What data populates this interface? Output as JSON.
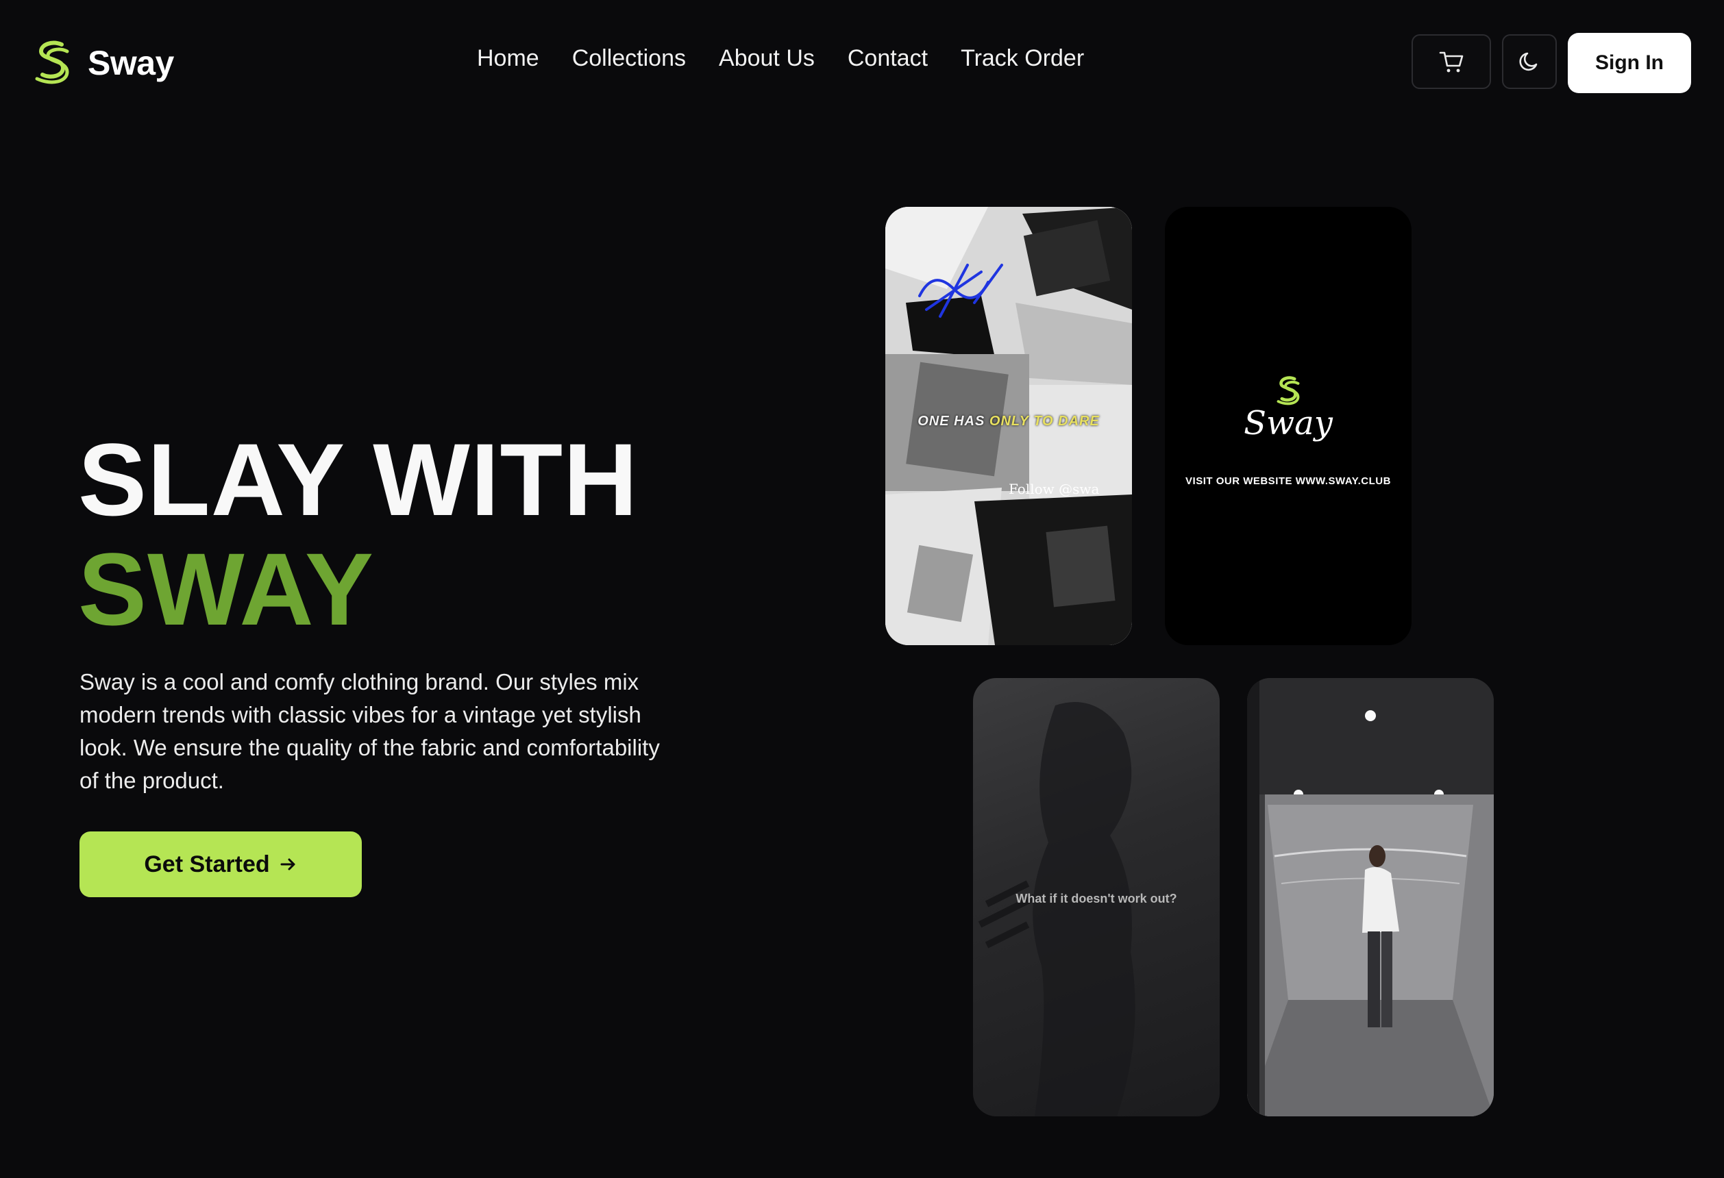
{
  "brand": {
    "name": "Sway",
    "accent_color": "#b5e554",
    "highlight_color": "#6ea532"
  },
  "nav": {
    "items": [
      {
        "label": "Home"
      },
      {
        "label": "Collections"
      },
      {
        "label": "About Us"
      },
      {
        "label": "Contact"
      },
      {
        "label": "Track Order"
      }
    ]
  },
  "header_actions": {
    "cart_icon": "cart-icon",
    "theme_icon": "moon-icon",
    "signin_label": "Sign In"
  },
  "hero": {
    "title_line1": "SLAY WITH",
    "title_line2": "SWAY",
    "description": "Sway is a cool and comfy clothing brand. Our styles mix modern trends with classic vibes for a vintage yet stylish look. We ensure the quality of the fabric and comfortability of the product.",
    "cta_label": "Get Started",
    "cta_icon": "arrow-right-icon"
  },
  "videos": [
    {
      "caption_prefix": "ONE HAS ",
      "caption_highlight": "ONLY TO DARE",
      "follow_text": "Follow @swa"
    },
    {
      "brand_text": "Sway",
      "visit_text": "VISIT OUR WEBSITE WWW.SWAY.CLUB"
    },
    {
      "overlay_text": "What if it doesn't work out?"
    },
    {
      "scene": "person in elevator"
    }
  ]
}
